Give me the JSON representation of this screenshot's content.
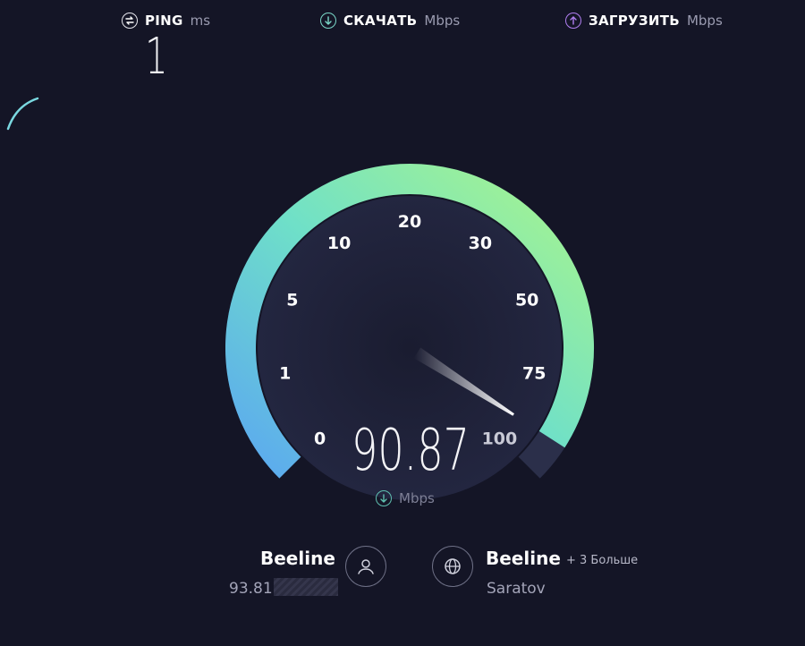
{
  "header": {
    "ping": {
      "label": "PING",
      "unit": "ms",
      "value": "1",
      "icon": "ping-icon"
    },
    "download": {
      "label": "СКАЧАТЬ",
      "unit": "Mbps",
      "icon": "download-arrow-icon",
      "color": "#7ad8c8"
    },
    "upload": {
      "label": "ЗАГРУЗИТЬ",
      "unit": "Mbps",
      "icon": "upload-arrow-icon",
      "color": "#b07ef0"
    }
  },
  "gauge": {
    "ticks": [
      "0",
      "1",
      "5",
      "10",
      "20",
      "30",
      "50",
      "75",
      "100"
    ],
    "max": 100,
    "current": 90.87,
    "value_text": "90.87",
    "unit": "Mbps",
    "colors": {
      "start": "#5ba8f0",
      "end": "#a9f58c",
      "track": "#2b2f4a"
    }
  },
  "client": {
    "provider": "Beeline",
    "ip": "93.81.",
    "icon": "user-icon"
  },
  "server": {
    "provider": "Beeline",
    "more": "+ 3 Больше",
    "city": "Saratov",
    "icon": "globe-icon"
  }
}
